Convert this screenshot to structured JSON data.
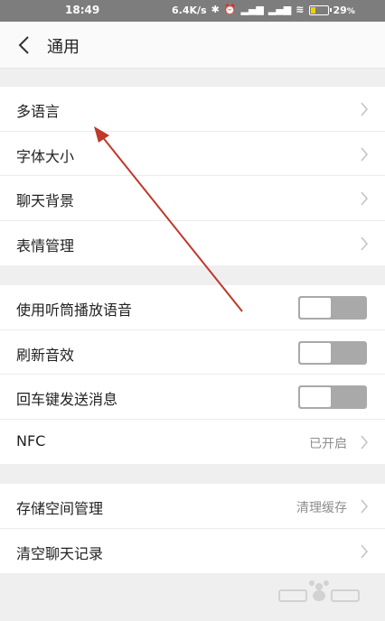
{
  "status_bar": {
    "time": "18:49",
    "net_speed": "6.4K/s",
    "battery": "29",
    "battery_unit": "%",
    "icons": [
      "bluetooth-icon",
      "alarm-icon",
      "signal-icon",
      "signal-icon",
      "wifi-icon",
      "battery-icon"
    ]
  },
  "header": {
    "title": "通用"
  },
  "group1": [
    {
      "label": "多语言"
    },
    {
      "label": "字体大小"
    },
    {
      "label": "聊天背景"
    },
    {
      "label": "表情管理"
    }
  ],
  "group2": [
    {
      "label": "使用听筒播放语音",
      "toggle": false
    },
    {
      "label": "刷新音效",
      "toggle": false
    },
    {
      "label": "回车键发送消息",
      "toggle": false
    },
    {
      "label": "NFC",
      "value": "已开启"
    }
  ],
  "group3": [
    {
      "label": "存储空间管理",
      "value": "清理缓存"
    },
    {
      "label": "清空聊天记录"
    }
  ],
  "colors": {
    "annotation_arrow": "#c0392b",
    "toggle_off": "#a9a9a9",
    "status_bar": "#7d7d7d"
  }
}
